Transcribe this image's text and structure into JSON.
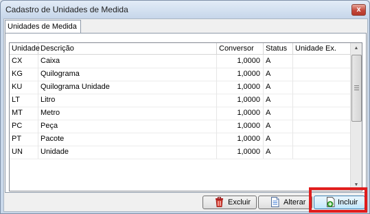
{
  "window": {
    "title": "Cadastro de Unidades de Medida",
    "close_glyph": "x"
  },
  "tabs": [
    {
      "label": "Unidades de Medida",
      "selected": true
    }
  ],
  "grid": {
    "columns": [
      "Unidade",
      "Descrição",
      "Conversor",
      "Status",
      "Unidade Ex."
    ],
    "rows": [
      {
        "unidade": "CX",
        "descricao": "Caixa",
        "conversor": "1,0000",
        "status": "A",
        "unidade_ex": ""
      },
      {
        "unidade": "KG",
        "descricao": "Quilograma",
        "conversor": "1,0000",
        "status": "A",
        "unidade_ex": ""
      },
      {
        "unidade": "KU",
        "descricao": "Quilograma Unidade",
        "conversor": "1,0000",
        "status": "A",
        "unidade_ex": ""
      },
      {
        "unidade": "LT",
        "descricao": "Litro",
        "conversor": "1,0000",
        "status": "A",
        "unidade_ex": ""
      },
      {
        "unidade": "MT",
        "descricao": "Metro",
        "conversor": "1,0000",
        "status": "A",
        "unidade_ex": ""
      },
      {
        "unidade": "PC",
        "descricao": "Peça",
        "conversor": "1,0000",
        "status": "A",
        "unidade_ex": ""
      },
      {
        "unidade": "PT",
        "descricao": "Pacote",
        "conversor": "1,0000",
        "status": "A",
        "unidade_ex": ""
      },
      {
        "unidade": "UN",
        "descricao": "Unidade",
        "conversor": "1,0000",
        "status": "A",
        "unidade_ex": ""
      }
    ]
  },
  "buttons": {
    "excluir": {
      "label": "Excluir",
      "icon": "trash-icon"
    },
    "alterar": {
      "label": "Alterar",
      "icon": "document-edit-icon"
    },
    "incluir": {
      "label": "Incluir",
      "icon": "add-document-icon",
      "highlighted": true
    }
  },
  "colors": {
    "highlight": "#e01d1d",
    "close_button": "#c4473a"
  }
}
